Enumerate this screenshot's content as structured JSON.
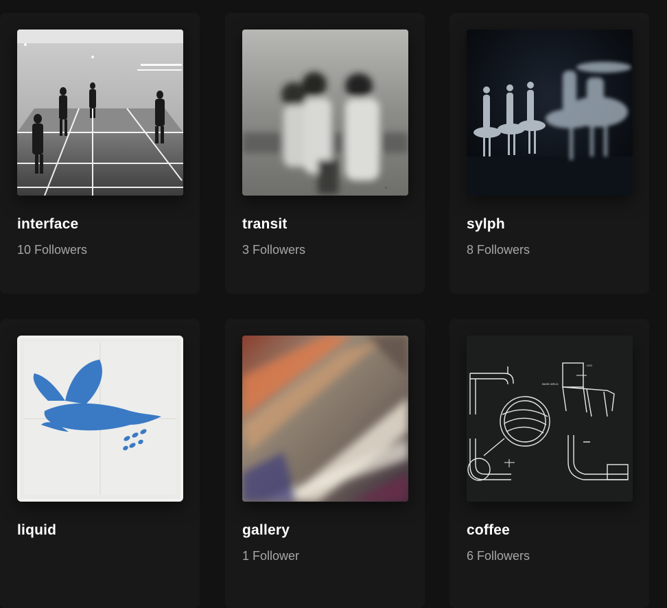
{
  "playlists": [
    {
      "title": "interface",
      "subtitle": "10 Followers",
      "cover": "gallery-room-photo"
    },
    {
      "title": "transit",
      "subtitle": "3 Followers",
      "cover": "blurred-figures-photo"
    },
    {
      "title": "sylph",
      "subtitle": "8 Followers",
      "cover": "ballet-dancers-photo"
    },
    {
      "title": "liquid",
      "subtitle": "",
      "cover": "blue-dove-print"
    },
    {
      "title": "gallery",
      "subtitle": "1 Follower",
      "cover": "abstract-light-streaks"
    },
    {
      "title": "coffee",
      "subtitle": "6 Followers",
      "cover": "chair-design-drawing"
    }
  ],
  "colors": {
    "background": "#121212",
    "card": "#181818",
    "title": "#ffffff",
    "subtitle": "#a7a7a7"
  }
}
